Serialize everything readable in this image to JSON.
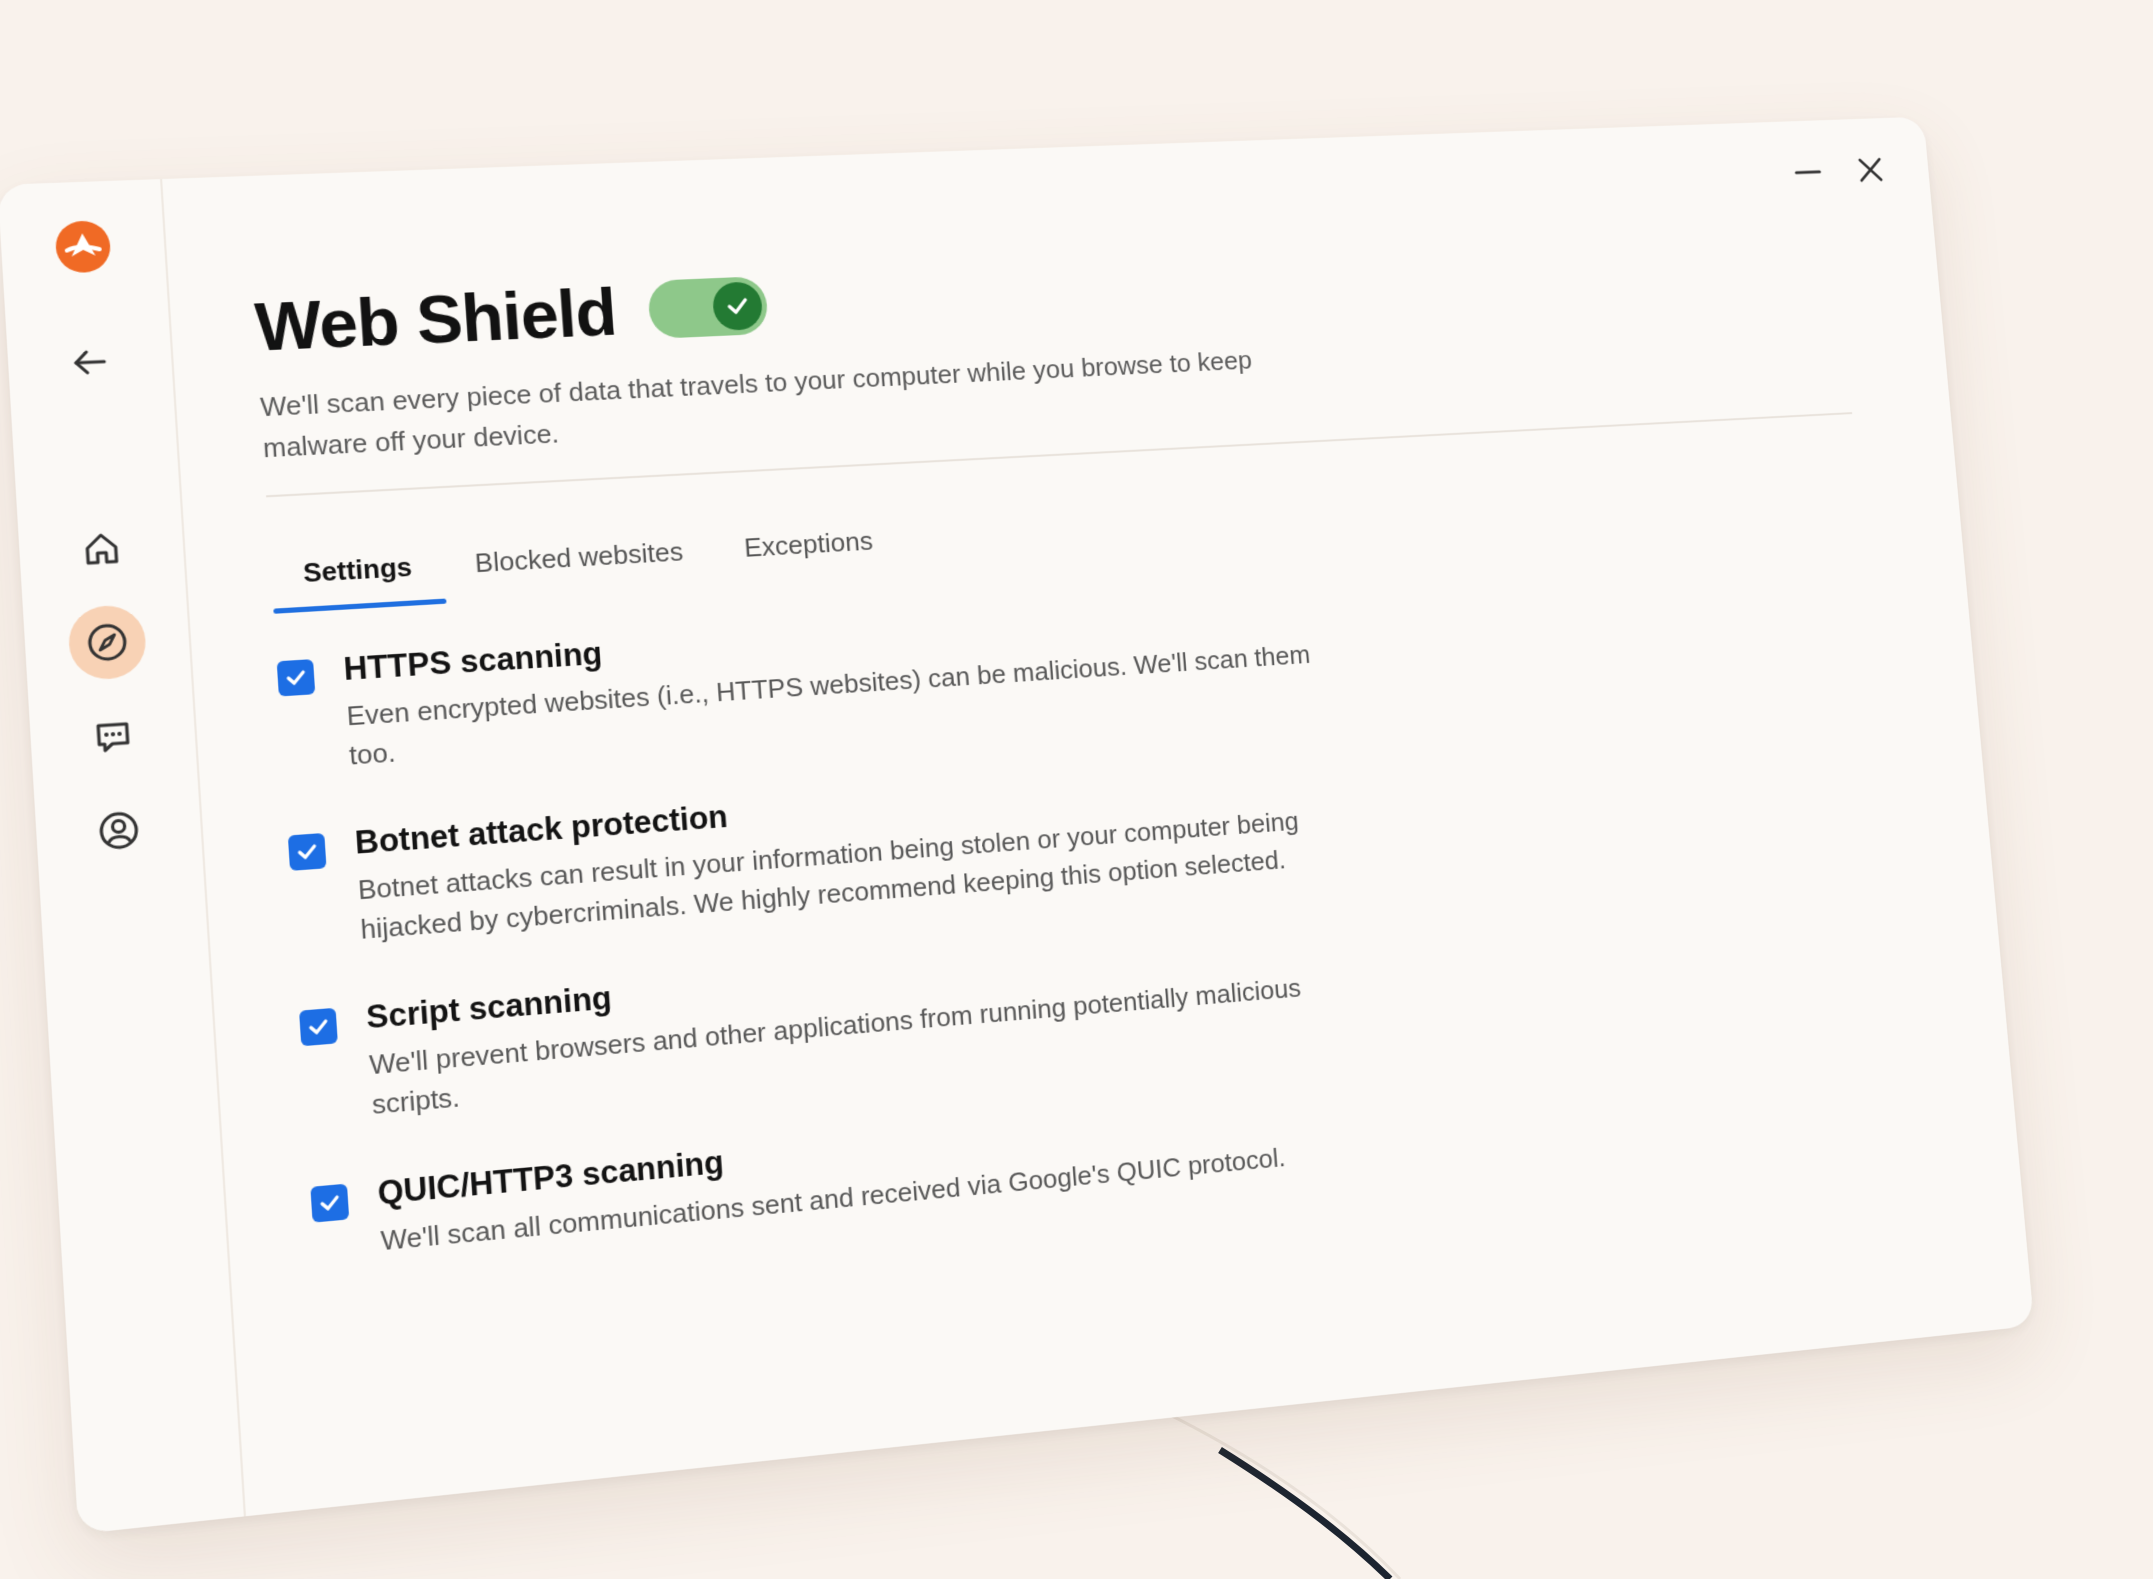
{
  "app": {
    "title": "Web Shield",
    "subtitle": "We'll scan every piece of data that travels to your computer while you browse to keep malware off your device.",
    "shield_enabled": true
  },
  "titlebar": {
    "minimize_icon": "minimize-icon",
    "close_icon": "close-icon"
  },
  "sidebar": {
    "logo_icon": "avast-logo",
    "items": [
      {
        "icon": "back-arrow-icon"
      },
      {
        "icon": "home-icon"
      },
      {
        "icon": "compass-icon",
        "active": true
      },
      {
        "icon": "chat-icon"
      },
      {
        "icon": "account-icon"
      }
    ]
  },
  "tabs": [
    {
      "label": "Settings",
      "active": true
    },
    {
      "label": "Blocked websites"
    },
    {
      "label": "Exceptions"
    }
  ],
  "options": [
    {
      "title": "HTTPS scanning",
      "description": "Even encrypted websites (i.e., HTTPS websites) can be malicious. We'll scan them too.",
      "checked": true
    },
    {
      "title": "Botnet attack protection",
      "description": "Botnet attacks can result in your information being stolen or your computer being hijacked by cybercriminals. We highly recommend keeping this option selected.",
      "checked": true
    },
    {
      "title": "Script scanning",
      "description": "We'll prevent browsers and other applications from running potentially malicious scripts.",
      "checked": true
    },
    {
      "title": "QUIC/HTTP3 scanning",
      "description": "We'll scan all communications sent and received via Google's QUIC protocol.",
      "checked": true
    }
  ],
  "colors": {
    "accent": "#1d6ee4",
    "toggle_on": "#8ec88a",
    "toggle_knob": "#237a33",
    "brand": "#f06a25",
    "active_nav_bg": "#f8d2b5",
    "background": "#f9f2ec"
  }
}
